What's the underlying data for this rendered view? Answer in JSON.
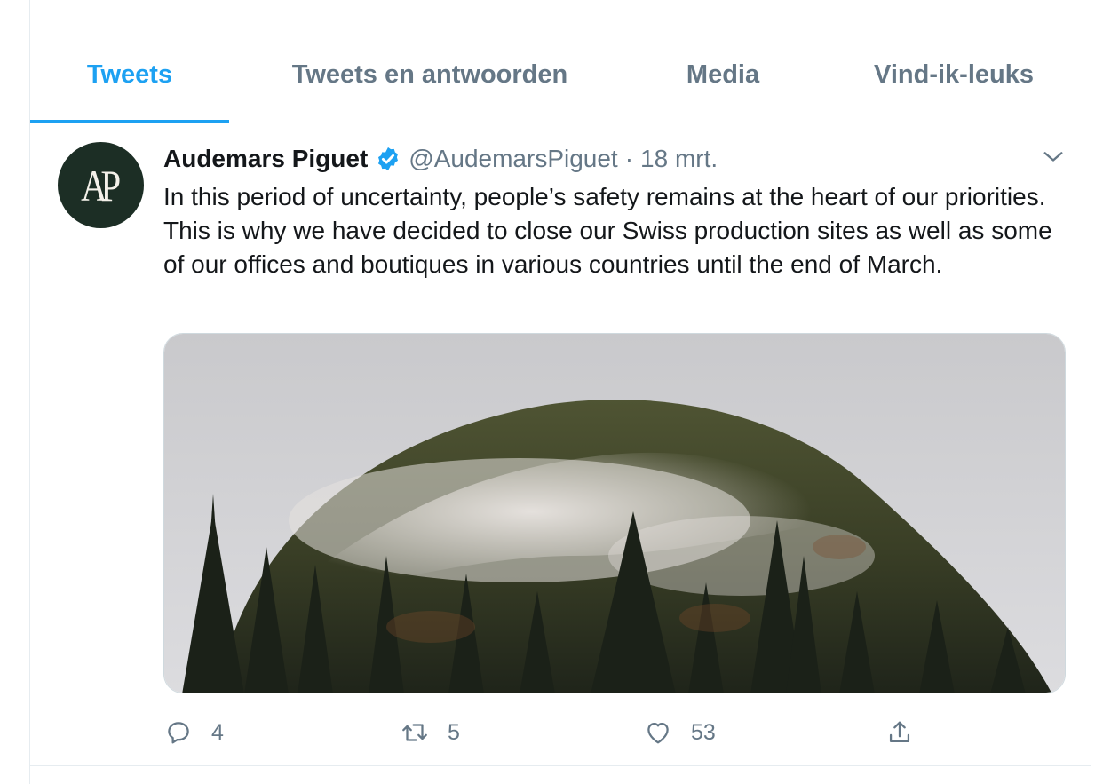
{
  "tabs": [
    {
      "label": "Tweets",
      "active": true
    },
    {
      "label": "Tweets en antwoorden",
      "active": false
    },
    {
      "label": "Media",
      "active": false
    },
    {
      "label": "Vind-ik-leuks",
      "active": false
    }
  ],
  "tweet": {
    "avatar_logo": "AP",
    "author_name": "Audemars Piguet",
    "verified_icon": "verified-badge-icon",
    "handle": "@AudemarsPiguet",
    "separator": "·",
    "timestamp": "18 mrt.",
    "text": "In this period of uncertainty, people’s safety remains at the heart of our priorities. This is why we have decided to close our Swiss production sites as well as some of our offices and boutiques in various countries until the end of March.",
    "media_icon": "misty-forest-hill-photo",
    "actions": {
      "reply_count": "4",
      "retweet_count": "5",
      "like_count": "53"
    }
  },
  "colors": {
    "accent": "#1da1f2",
    "muted": "#657786",
    "text": "#14171a",
    "avatar_bg": "#1c2e25",
    "border": "#e6ecf0"
  }
}
